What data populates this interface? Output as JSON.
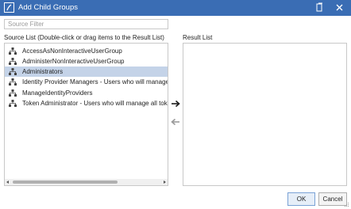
{
  "window": {
    "title": "Add Child Groups",
    "accent": "#3a6db4",
    "icons": [
      "app-logo-icon",
      "restore-icon",
      "close-icon"
    ]
  },
  "filter": {
    "placeholder": "Source Filter",
    "value": ""
  },
  "source": {
    "label": "Source List (Double-click or drag items to the Result List)",
    "items": [
      {
        "label": "AccessAsNonInteractiveUserGroup",
        "icon": "group-icon",
        "selected": false
      },
      {
        "label": "AdministerNonInteractiveUserGroup",
        "icon": "group-icon",
        "selected": false
      },
      {
        "label": "Administrators",
        "icon": "group-icon",
        "selected": true
      },
      {
        "label": "Identity Provider Managers - Users who will manage identity providers",
        "icon": "group-icon",
        "selected": false
      },
      {
        "label": "ManageIdentityProviders",
        "icon": "group-icon",
        "selected": false
      },
      {
        "label": "Token Administrator - Users who will manage all tokens",
        "icon": "group-icon",
        "selected": false
      }
    ],
    "selected_color": "#c4d3e8"
  },
  "result": {
    "label": "Result List",
    "items": []
  },
  "actions": {
    "move_right_icon": "arrow-right-icon",
    "move_left_icon": "arrow-left-icon"
  },
  "buttons": {
    "ok": "OK",
    "cancel": "Cancel"
  }
}
